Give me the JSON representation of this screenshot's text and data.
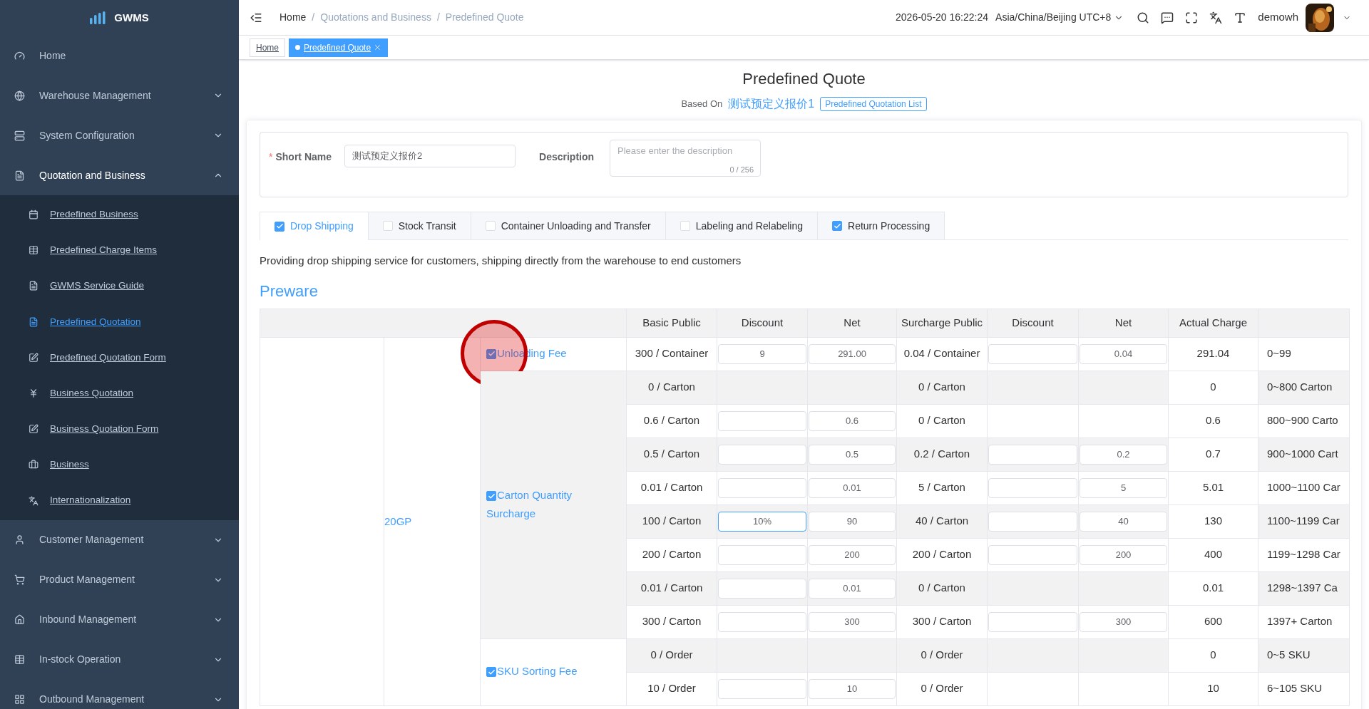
{
  "sidebar": {
    "logo": "GWMS",
    "items": [
      {
        "label": "Home"
      },
      {
        "label": "Warehouse Management",
        "expanded": false
      },
      {
        "label": "System Configuration",
        "expanded": false
      },
      {
        "label": "Quotation and Business",
        "expanded": true,
        "children": [
          {
            "label": "Predefined Business",
            "selected": false
          },
          {
            "label": "Predefined Charge Items",
            "selected": false
          },
          {
            "label": "GWMS Service Guide",
            "selected": false
          },
          {
            "label": "Predefined Quotation",
            "selected": true
          },
          {
            "label": "Predefined Quotation Form",
            "selected": false
          },
          {
            "label": "Business Quotation",
            "selected": false
          },
          {
            "label": "Business Quotation Form",
            "selected": false
          },
          {
            "label": "Business",
            "selected": false
          },
          {
            "label": "Internationalization",
            "selected": false
          }
        ]
      },
      {
        "label": "Customer Management",
        "expanded": false
      },
      {
        "label": "Product Management",
        "expanded": false
      },
      {
        "label": "Inbound Management",
        "expanded": false
      },
      {
        "label": "In-stock Operation",
        "expanded": false
      },
      {
        "label": "Outbound Management",
        "expanded": false
      }
    ]
  },
  "header": {
    "breadcrumb": [
      "Home",
      "Quotations and Business",
      "Predefined Quote"
    ],
    "separator": "/",
    "datetime": "2026-05-20 16:22:24",
    "timezone": "Asia/China/Beijing UTC+8",
    "user": "demowh"
  },
  "page_tabs": [
    {
      "label": "Home",
      "selected": false,
      "closable": false
    },
    {
      "label": "Predefined Quote",
      "selected": true,
      "closable": true
    }
  ],
  "title": "Predefined Quote",
  "based_on": {
    "label": "Based On",
    "value": "测试预定义报价1",
    "tag": "Predefined Quotation List"
  },
  "form": {
    "short_name": {
      "label": "Short Name",
      "required_mark": "*",
      "value": "测试预定义报价2"
    },
    "description": {
      "label": "Description",
      "placeholder": "Please enter the description",
      "counter": "0 / 256"
    }
  },
  "service_tabs": [
    {
      "label": "Drop Shipping",
      "checked": true,
      "selected": true
    },
    {
      "label": "Stock Transit",
      "checked": false,
      "selected": false
    },
    {
      "label": "Container Unloading and Transfer",
      "checked": false,
      "selected": false
    },
    {
      "label": "Labeling and Relabeling",
      "checked": false,
      "selected": false
    },
    {
      "label": "Return Processing",
      "checked": true,
      "selected": false
    }
  ],
  "service_description": "Providing drop shipping service for customers, shipping directly from the warehouse to end customers",
  "section_title": "Preware",
  "table": {
    "columns": [
      "Basic Public",
      "Discount",
      "Net",
      "Surcharge Public",
      "Discount",
      "Net",
      "Actual Charge"
    ],
    "container": "20GP",
    "groups": [
      {
        "name": "Unloading Fee",
        "checked": true,
        "rows": [
          {
            "basic": "300 / Container",
            "discount": {
              "field": true,
              "value": "9"
            },
            "net": {
              "field": true,
              "value": "291.00"
            },
            "surcharge": "0.04 / Container",
            "discount2": {
              "field": true
            },
            "net2": {
              "field": true,
              "value": "0.04"
            },
            "actual": "291.04",
            "range": "0~99"
          }
        ]
      },
      {
        "name": "Carton Quantity Surcharge",
        "checked": true,
        "rows": [
          {
            "basic": "0 / Carton",
            "discount": {
              "field": false
            },
            "net": {
              "field": false
            },
            "surcharge": "0 / Carton",
            "discount2": {
              "field": false
            },
            "net2": {
              "field": false
            },
            "actual": "0",
            "range": "0~800 Carton"
          },
          {
            "basic": "0.6 / Carton",
            "discount": {
              "field": true
            },
            "net": {
              "field": true,
              "value": "0.6"
            },
            "surcharge": "0 / Carton",
            "discount2": {
              "field": false
            },
            "net2": {
              "field": false
            },
            "actual": "0.6",
            "range": "800~900 Carto"
          },
          {
            "basic": "0.5 / Carton",
            "discount": {
              "field": true
            },
            "net": {
              "field": true,
              "value": "0.5"
            },
            "surcharge": "0.2 / Carton",
            "discount2": {
              "field": true
            },
            "net2": {
              "field": true,
              "value": "0.2"
            },
            "actual": "0.7",
            "range": "900~1000 Cart"
          },
          {
            "basic": "0.01 / Carton",
            "discount": {
              "field": true
            },
            "net": {
              "field": true,
              "value": "0.01"
            },
            "surcharge": "5 / Carton",
            "discount2": {
              "field": true
            },
            "net2": {
              "field": true,
              "value": "5"
            },
            "actual": "5.01",
            "range": "1000~1100 Car"
          },
          {
            "basic": "100 / Carton",
            "discount": {
              "field": true,
              "value": "10%",
              "focused": true
            },
            "net": {
              "field": true,
              "value": "90"
            },
            "surcharge": "40 / Carton",
            "discount2": {
              "field": true
            },
            "net2": {
              "field": true,
              "value": "40"
            },
            "actual": "130",
            "range": "1100~1199 Car"
          },
          {
            "basic": "200 / Carton",
            "discount": {
              "field": true
            },
            "net": {
              "field": true,
              "value": "200"
            },
            "surcharge": "200 / Carton",
            "discount2": {
              "field": true
            },
            "net2": {
              "field": true,
              "value": "200"
            },
            "actual": "400",
            "range": "1199~1298 Car"
          },
          {
            "basic": "0.01 / Carton",
            "discount": {
              "field": true
            },
            "net": {
              "field": true,
              "value": "0.01"
            },
            "surcharge": "0 / Carton",
            "discount2": {
              "field": false
            },
            "net2": {
              "field": false
            },
            "actual": "0.01",
            "range": "1298~1397 Ca"
          },
          {
            "basic": "300 / Carton",
            "discount": {
              "field": true
            },
            "net": {
              "field": true,
              "value": "300"
            },
            "surcharge": "300 / Carton",
            "discount2": {
              "field": true
            },
            "net2": {
              "field": true,
              "value": "300"
            },
            "actual": "600",
            "range": "1397+ Carton"
          }
        ]
      },
      {
        "name": "SKU Sorting Fee",
        "checked": true,
        "rows": [
          {
            "basic": "0 / Order",
            "discount": {
              "field": false
            },
            "net": {
              "field": false
            },
            "surcharge": "0 / Order",
            "discount2": {
              "field": false
            },
            "net2": {
              "field": false
            },
            "actual": "0",
            "range": "0~5 SKU"
          },
          {
            "basic": "10 / Order",
            "discount": {
              "field": true
            },
            "net": {
              "field": true,
              "value": "10"
            },
            "surcharge": "0 / Order",
            "discount2": {
              "field": false
            },
            "net2": {
              "field": false
            },
            "actual": "10",
            "range": "6~105 SKU"
          }
        ]
      }
    ]
  }
}
